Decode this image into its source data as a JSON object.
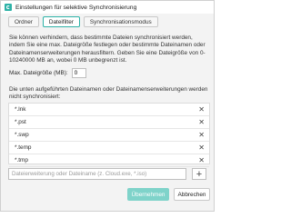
{
  "window": {
    "title": "Einstellungen für selektive Synchronisierung"
  },
  "tabs": [
    {
      "label": "Ordner",
      "active": false
    },
    {
      "label": "Dateifilter",
      "active": true
    },
    {
      "label": "Synchronisationsmodus",
      "active": false
    }
  ],
  "description": "Sie können verhindern, dass bestimmte Dateien synchronisiert werden, indem Sie eine max. Dateigröße festlegen oder bestimmte Dateinamen oder Dateinamenserweiterungen herausfiltern. Geben Sie eine Dateigröße von 0-10240000 MB an, wobei 0 MB unbegrenzt ist.",
  "max_size": {
    "label": "Max. Dateigröße (MB):",
    "value": "0"
  },
  "list_description": "Die unten aufgeführten Dateinamen oder Dateinamenserweiterungen werden nicht synchronisiert:",
  "excluded": [
    "*.lnk",
    "*.pst",
    "*.swp",
    "*.temp",
    "*.tmp"
  ],
  "add": {
    "placeholder": "Dateierweiterung oder Dateiname (z. Cloud.exe, *.iso)",
    "button": "+"
  },
  "buttons": {
    "ok": "Übernehmen",
    "cancel": "Abbrechen"
  },
  "colors": {
    "accent": "#2eb2a7",
    "ok_button": "#7fd3ca"
  },
  "icons": {
    "app": "sync-app-icon",
    "remove": "close-icon",
    "add": "plus-icon"
  }
}
